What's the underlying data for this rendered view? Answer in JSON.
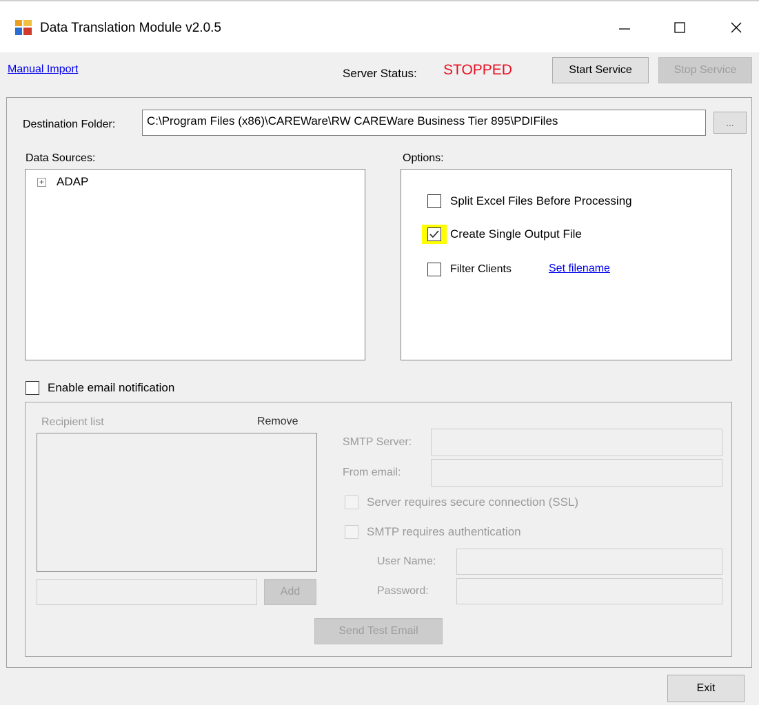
{
  "window": {
    "title": "Data Translation Module  v2.0.5",
    "minimize_glyph": "—",
    "maximize_glyph": "☐",
    "close_glyph": "✕"
  },
  "top": {
    "manual_import_label": "Manual Import",
    "server_status_label": "Server Status:",
    "server_status_value": "STOPPED",
    "status_color": "#e81123",
    "start_service_label": "Start Service",
    "stop_service_label": "Stop Service"
  },
  "destination": {
    "label": "Destination Folder:",
    "value": "C:\\Program Files (x86)\\CAREWare\\RW CAREWare Business Tier 895\\PDIFiles",
    "browse_label": "..."
  },
  "data_sources": {
    "label": "Data Sources:",
    "expand_glyph": "+",
    "items": [
      "ADAP"
    ]
  },
  "options": {
    "label": "Options:",
    "split_excel": {
      "label": "Split Excel Files Before Processing",
      "checked": false
    },
    "single_output": {
      "label": "Create Single Output File",
      "checked": true
    },
    "filter_clients": {
      "label": "Filter Clients",
      "checked": false
    },
    "set_filename_label": "Set filename"
  },
  "email": {
    "enable_label": "Enable email notification",
    "enabled": false,
    "recipient_list_label": "Recipient list",
    "remove_label": "Remove",
    "add_label": "Add",
    "smtp_server_label": "SMTP Server:",
    "from_email_label": "From email:",
    "ssl_label": "Server requires secure connection (SSL)",
    "auth_label": "SMTP requires authentication",
    "username_label": "User Name:",
    "password_label": "Password:",
    "send_test_label": "Send Test Email"
  },
  "footer": {
    "exit_label": "Exit"
  },
  "colors": {
    "highlight": "#ffff00",
    "link": "#0000ee"
  }
}
